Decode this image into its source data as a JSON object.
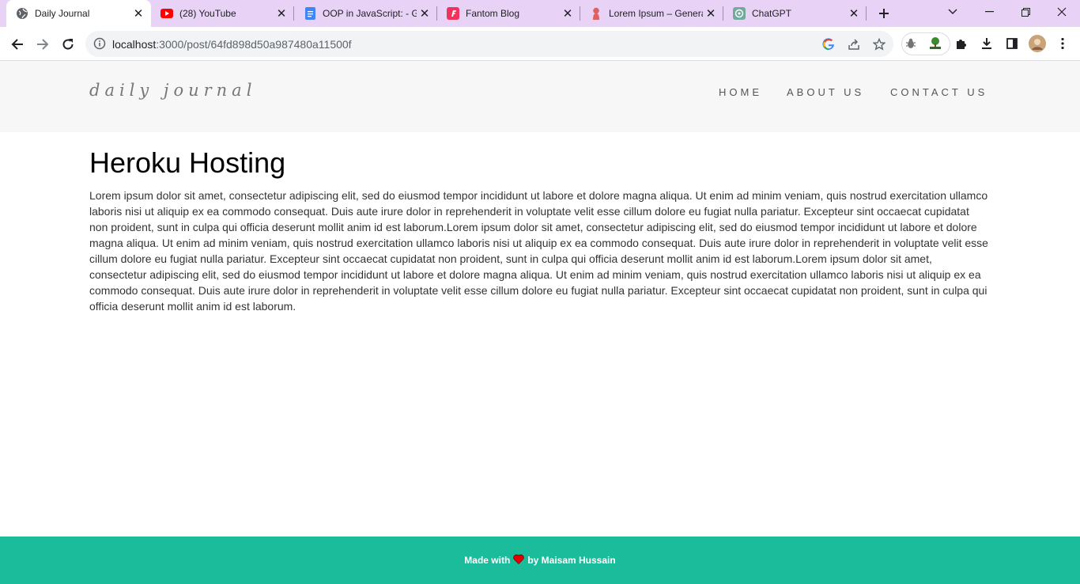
{
  "browser": {
    "tabs": [
      {
        "title": "Daily Journal",
        "icon": "globe-icon",
        "active": true
      },
      {
        "title": "(28) YouTube",
        "icon": "youtube-icon",
        "active": false
      },
      {
        "title": "OOP in JavaScript: - G",
        "icon": "google-docs-icon",
        "active": false
      },
      {
        "title": "Fantom Blog",
        "icon": "fantom-icon",
        "active": false
      },
      {
        "title": "Lorem Ipsum – Genera",
        "icon": "lorem-ipsum-icon",
        "active": false
      },
      {
        "title": "ChatGPT",
        "icon": "chatgpt-icon",
        "active": false
      }
    ],
    "url_host": "localhost",
    "url_rest": ":3000/post/64fd898d50a987480a11500f"
  },
  "site": {
    "brand": "daily journal",
    "nav": {
      "home": "HOME",
      "about": "ABOUT US",
      "contact": "CONTACT US"
    }
  },
  "post": {
    "title": "Heroku Hosting",
    "body": "Lorem ipsum dolor sit amet, consectetur adipiscing elit, sed do eiusmod tempor incididunt ut labore et dolore magna aliqua. Ut enim ad minim veniam, quis nostrud exercitation ullamco laboris nisi ut aliquip ex ea commodo consequat. Duis aute irure dolor in reprehenderit in voluptate velit esse cillum dolore eu fugiat nulla pariatur. Excepteur sint occaecat cupidatat non proident, sunt in culpa qui officia deserunt mollit anim id est laborum.Lorem ipsum dolor sit amet, consectetur adipiscing elit, sed do eiusmod tempor incididunt ut labore et dolore magna aliqua. Ut enim ad minim veniam, quis nostrud exercitation ullamco laboris nisi ut aliquip ex ea commodo consequat. Duis aute irure dolor in reprehenderit in voluptate velit esse cillum dolore eu fugiat nulla pariatur. Excepteur sint occaecat cupidatat non proident, sunt in culpa qui officia deserunt mollit anim id est laborum.Lorem ipsum dolor sit amet, consectetur adipiscing elit, sed do eiusmod tempor incididunt ut labore et dolore magna aliqua. Ut enim ad minim veniam, quis nostrud exercitation ullamco laboris nisi ut aliquip ex ea commodo consequat. Duis aute irure dolor in reprehenderit in voluptate velit esse cillum dolore eu fugiat nulla pariatur. Excepteur sint occaecat cupidatat non proident, sunt in culpa qui officia deserunt mollit anim id est laborum."
  },
  "footer": {
    "made_with": "Made with",
    "by": "by Maisam Hussain"
  },
  "colors": {
    "tabstrip": "#e8d3f7",
    "footer": "#1abc9c",
    "heart": "#e00000"
  }
}
